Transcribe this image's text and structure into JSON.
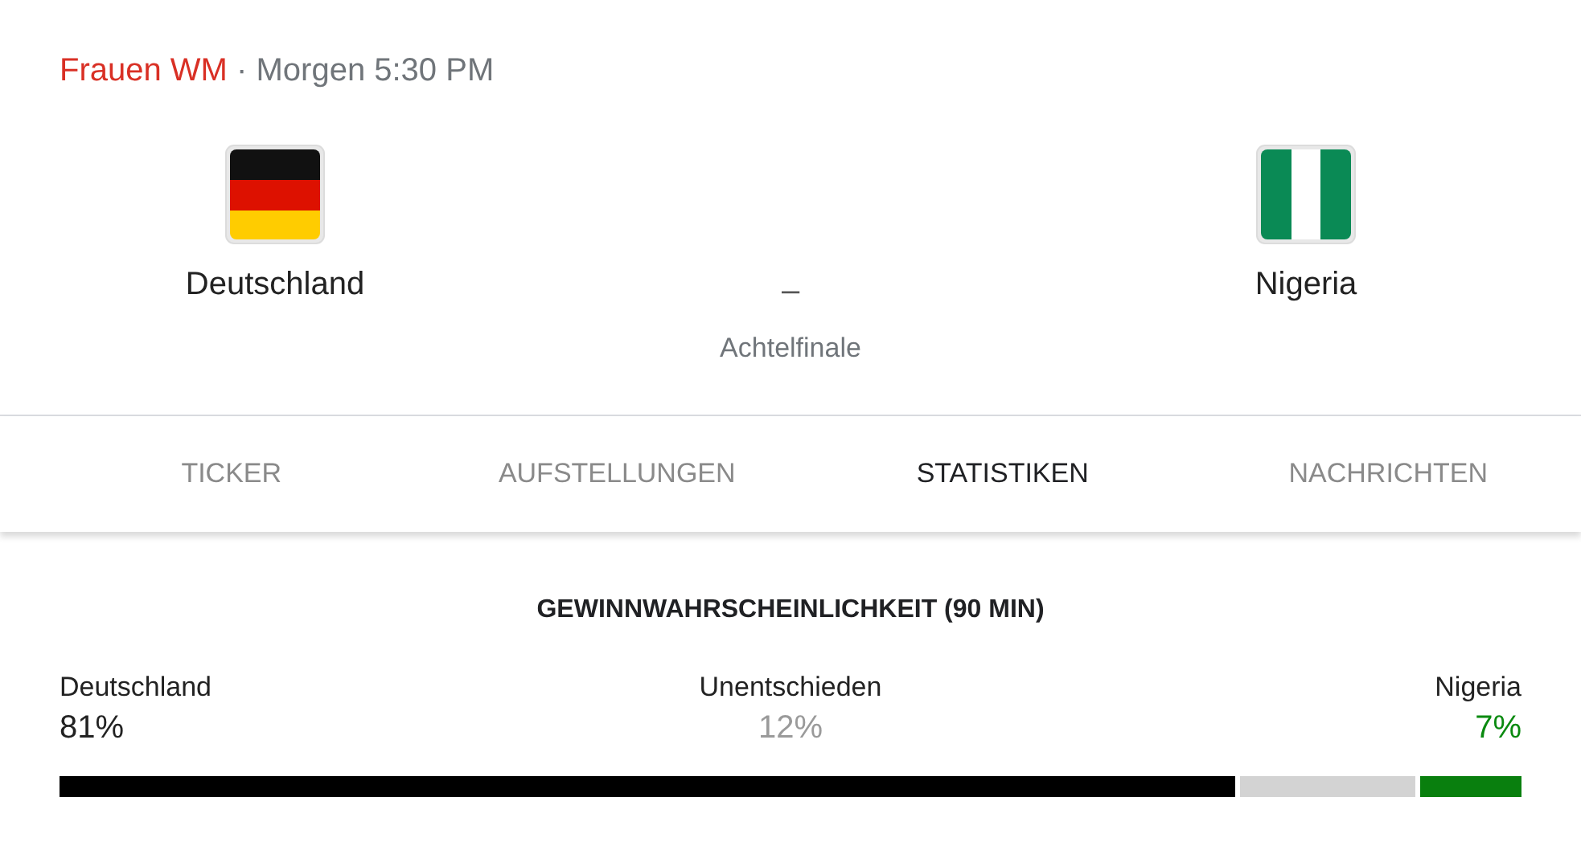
{
  "header": {
    "competition": "Frauen WM",
    "time": "· Morgen 5:30 PM"
  },
  "match": {
    "teams": [
      {
        "name": "Deutschland"
      },
      {
        "name": "Nigeria"
      }
    ],
    "score": "–",
    "round": "Achtelfinale"
  },
  "tabs": [
    {
      "label": "TICKER",
      "selected": false
    },
    {
      "label": "AUFSTELLUNGEN",
      "selected": false
    },
    {
      "label": "STATISTIKEN",
      "selected": true
    },
    {
      "label": "NACHRICHTEN",
      "selected": false
    }
  ],
  "probability": {
    "title": "GEWINNWAHRSCHEINLICHKEIT (90 MIN)",
    "outcomes": [
      {
        "kind": "home",
        "label": "Deutschland",
        "value": "81%",
        "color": "#000000"
      },
      {
        "kind": "draw",
        "label": "Unentschieden",
        "value": "12%",
        "color": "#d3d3d3"
      },
      {
        "kind": "away",
        "label": "Nigeria",
        "value": "7%",
        "color": "#097f0e"
      }
    ]
  }
}
